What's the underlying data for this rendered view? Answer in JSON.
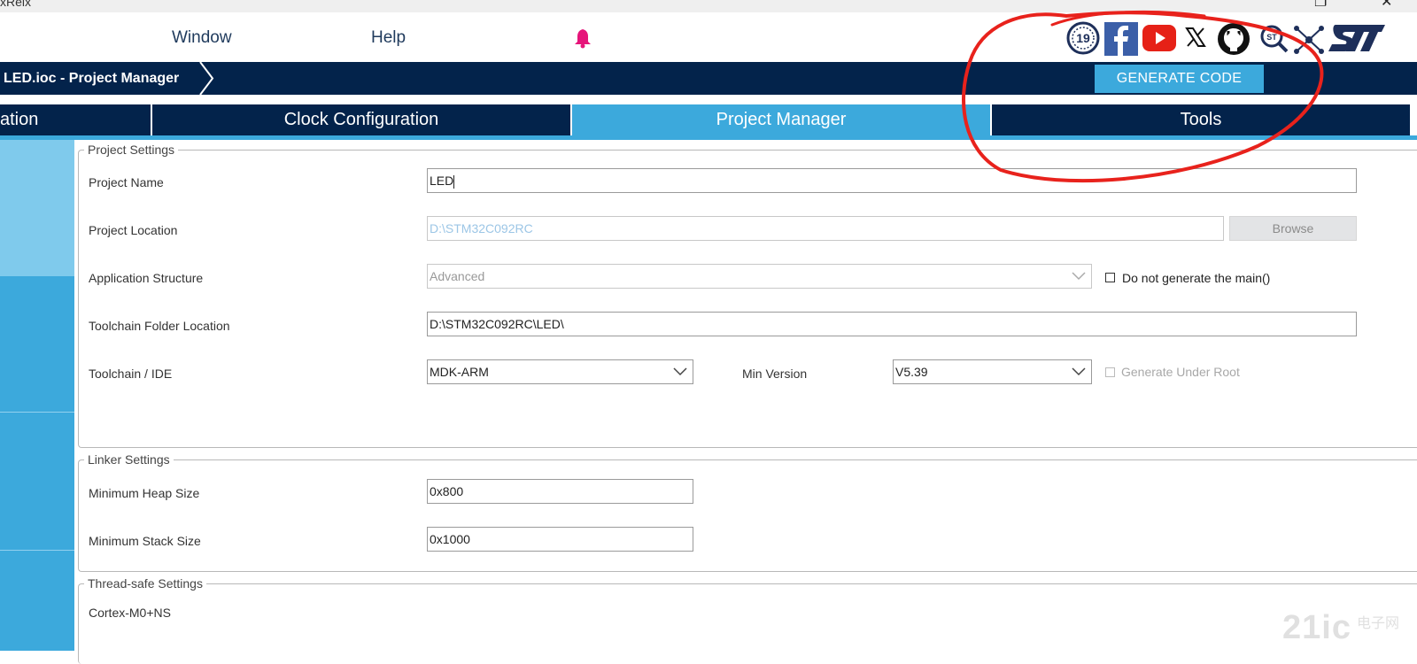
{
  "window": {
    "app_title_fragment": "xReix",
    "maximize_glyph": "❐",
    "close_glyph": "✕"
  },
  "menubar": {
    "items": [
      "Window",
      "Help"
    ]
  },
  "header": {
    "breadcrumb": "LED.ioc - Project Manager",
    "generate_code_label": "GENERATE CODE"
  },
  "tabs": [
    {
      "label": "ation",
      "active": false
    },
    {
      "label": "Clock Configuration",
      "active": false
    },
    {
      "label": "Project Manager",
      "active": true
    },
    {
      "label": "Tools",
      "active": false
    }
  ],
  "project_settings": {
    "legend": "Project Settings",
    "project_name_label": "Project Name",
    "project_name_value": "LED",
    "project_location_label": "Project Location",
    "project_location_value": "D:\\STM32C092RC",
    "browse_label": "Browse",
    "app_structure_label": "Application Structure",
    "app_structure_value": "Advanced",
    "no_main_label": "Do not generate the main()",
    "toolchain_folder_label": "Toolchain Folder Location",
    "toolchain_folder_value": "D:\\STM32C092RC\\LED\\",
    "toolchain_ide_label": "Toolchain / IDE",
    "toolchain_ide_value": "MDK-ARM",
    "min_version_label": "Min Version",
    "min_version_value": "V5.39",
    "generate_under_root_label": "Generate Under Root"
  },
  "linker_settings": {
    "legend": "Linker Settings",
    "heap_label": "Minimum Heap Size",
    "heap_value": "0x800",
    "stack_label": "Minimum Stack Size",
    "stack_value": "0x1000"
  },
  "thread_safe_settings": {
    "legend": "Thread-safe Settings",
    "core_label": "Cortex-M0+NS"
  },
  "social_icons": [
    "anniversary-19-icon",
    "facebook-icon",
    "youtube-icon",
    "x-twitter-icon",
    "github-icon",
    "community-search-icon",
    "network-share-icon",
    "st-logo"
  ],
  "colors": {
    "navy": "#03234b",
    "accent": "#3ca9dc",
    "annotation_red": "#e8221c"
  },
  "watermark": {
    "text_main": "21ic",
    "text_cn": "电子网"
  }
}
